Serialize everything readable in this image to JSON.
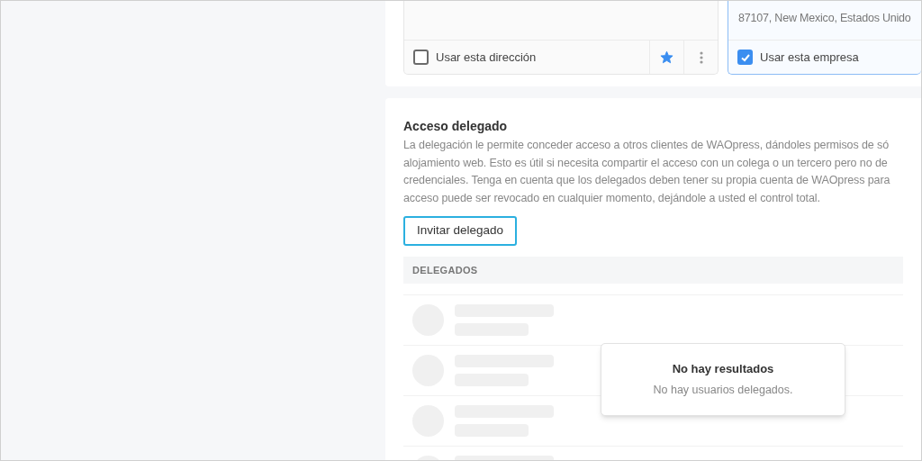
{
  "address_cards": [
    {
      "label": "Usar esta dirección",
      "checked": false,
      "starred": true
    },
    {
      "address": "87107, New Mexico, Estados Unido",
      "label": "Usar esta empresa",
      "checked": true
    }
  ],
  "delegated_access": {
    "title": "Acceso delegado",
    "description_lines": [
      "La delegación le permite conceder acceso a otros clientes de WAOpress, dándoles permisos de só",
      "alojamiento web. Esto es útil si necesita compartir el acceso con un colega o un tercero pero no de",
      "credenciales. Tenga en cuenta que los delegados deben tener su propia cuenta de WAOpress para",
      "acceso puede ser revocado en cualquier momento, dejándole a usted el control total."
    ],
    "invite_button": "Invitar delegado",
    "table_header": "DELEGADOS",
    "empty_state": {
      "title": "No hay resultados",
      "message": "No hay usuarios delegados."
    }
  }
}
